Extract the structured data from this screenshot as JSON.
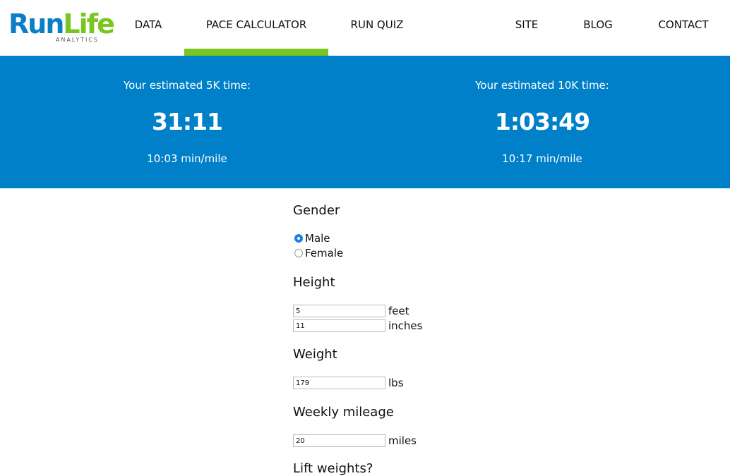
{
  "logo": {
    "run": "Run",
    "life": "Life",
    "sub": "ANALYTICS"
  },
  "nav": {
    "items": [
      {
        "label": "DATA"
      },
      {
        "label": "PACE CALCULATOR",
        "active": true
      },
      {
        "label": "RUN QUIZ"
      },
      {
        "label": "SITE"
      },
      {
        "label": "BLOG"
      },
      {
        "label": "CONTACT"
      }
    ]
  },
  "colors": {
    "brand_blue": "#0080c9",
    "brand_green": "#7ac520"
  },
  "results": {
    "five_k": {
      "label": "Your estimated 5K time:",
      "time": "31:11",
      "pace": "10:03 min/mile"
    },
    "ten_k": {
      "label": "Your estimated 10K time:",
      "time": "1:03:49",
      "pace": "10:17 min/mile"
    }
  },
  "form": {
    "gender": {
      "label": "Gender",
      "options": [
        "Male",
        "Female"
      ],
      "selected": "Male"
    },
    "height": {
      "label": "Height",
      "feet_value": "5",
      "feet_unit": "feet",
      "inches_value": "11",
      "inches_unit": "inches"
    },
    "weight": {
      "label": "Weight",
      "value": "179",
      "unit": "lbs"
    },
    "mileage": {
      "label": "Weekly mileage",
      "value": "20",
      "unit": "miles"
    },
    "lift": {
      "label": "Lift weights?"
    }
  }
}
